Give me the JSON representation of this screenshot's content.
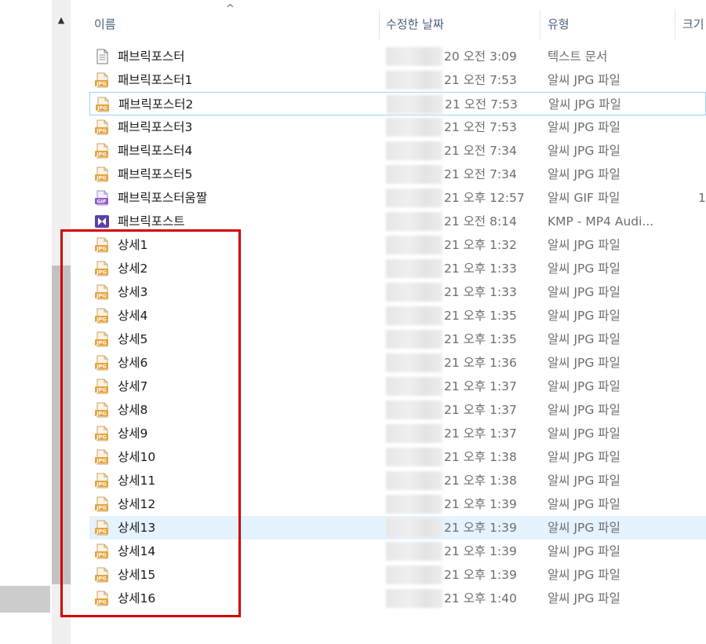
{
  "header": {
    "name": "이름",
    "date": "수정한 날짜",
    "type": "유형",
    "size": "크기"
  },
  "colors": {
    "header_text": "#4c607a",
    "secondary_text": "#6d6d6d",
    "selected_bg": "#e5f3ff",
    "focus_border": "#99d1ff",
    "annotation_red": "#d40000",
    "jpg_icon": "#e8a33d",
    "gif_icon": "#8b5cc9",
    "kmp_icon": "#5b3fa8"
  },
  "files": [
    {
      "icon": "text-file-icon",
      "name": "패브릭포스터",
      "date": "20 오전 3:09",
      "type": "텍스트 문서",
      "size": ""
    },
    {
      "icon": "jpg-file-icon",
      "name": "패브릭포스터1",
      "date": "21 오전 7:53",
      "type": "알씨 JPG 파일",
      "size": ""
    },
    {
      "icon": "jpg-file-icon",
      "name": "패브릭포스터2",
      "date": "21 오전 7:53",
      "type": "알씨 JPG 파일",
      "size": "",
      "state": "focused"
    },
    {
      "icon": "jpg-file-icon",
      "name": "패브릭포스터3",
      "date": "21 오전 7:53",
      "type": "알씨 JPG 파일",
      "size": ""
    },
    {
      "icon": "jpg-file-icon",
      "name": "패브릭포스터4",
      "date": "21 오전 7:34",
      "type": "알씨 JPG 파일",
      "size": ""
    },
    {
      "icon": "jpg-file-icon",
      "name": "패브릭포스터5",
      "date": "21 오전 7:34",
      "type": "알씨 JPG 파일",
      "size": ""
    },
    {
      "icon": "gif-file-icon",
      "name": "패브릭포스터움짤",
      "date": "21 오후 12:57",
      "type": "알씨 GIF 파일",
      "size": "1"
    },
    {
      "icon": "kmp-video-icon",
      "name": "패브릭포스트",
      "date": "21 오전 8:14",
      "type": "KMP - MP4 Audi...",
      "size": ""
    },
    {
      "icon": "jpg-file-icon",
      "name": "상세1",
      "date": "21 오후 1:32",
      "type": "알씨 JPG 파일",
      "size": ""
    },
    {
      "icon": "jpg-file-icon",
      "name": "상세2",
      "date": "21 오후 1:33",
      "type": "알씨 JPG 파일",
      "size": ""
    },
    {
      "icon": "jpg-file-icon",
      "name": "상세3",
      "date": "21 오후 1:33",
      "type": "알씨 JPG 파일",
      "size": ""
    },
    {
      "icon": "jpg-file-icon",
      "name": "상세4",
      "date": "21 오후 1:35",
      "type": "알씨 JPG 파일",
      "size": ""
    },
    {
      "icon": "jpg-file-icon",
      "name": "상세5",
      "date": "21 오후 1:35",
      "type": "알씨 JPG 파일",
      "size": ""
    },
    {
      "icon": "jpg-file-icon",
      "name": "상세6",
      "date": "21 오후 1:36",
      "type": "알씨 JPG 파일",
      "size": ""
    },
    {
      "icon": "jpg-file-icon",
      "name": "상세7",
      "date": "21 오후 1:37",
      "type": "알씨 JPG 파일",
      "size": ""
    },
    {
      "icon": "jpg-file-icon",
      "name": "상세8",
      "date": "21 오후 1:37",
      "type": "알씨 JPG 파일",
      "size": ""
    },
    {
      "icon": "jpg-file-icon",
      "name": "상세9",
      "date": "21 오후 1:37",
      "type": "알씨 JPG 파일",
      "size": ""
    },
    {
      "icon": "jpg-file-icon",
      "name": "상세10",
      "date": "21 오후 1:38",
      "type": "알씨 JPG 파일",
      "size": ""
    },
    {
      "icon": "jpg-file-icon",
      "name": "상세11",
      "date": "21 오후 1:38",
      "type": "알씨 JPG 파일",
      "size": ""
    },
    {
      "icon": "jpg-file-icon",
      "name": "상세12",
      "date": "21 오후 1:39",
      "type": "알씨 JPG 파일",
      "size": ""
    },
    {
      "icon": "jpg-file-icon",
      "name": "상세13",
      "date": "21 오후 1:39",
      "type": "알씨 JPG 파일",
      "size": "",
      "state": "selected"
    },
    {
      "icon": "jpg-file-icon",
      "name": "상세14",
      "date": "21 오후 1:39",
      "type": "알씨 JPG 파일",
      "size": ""
    },
    {
      "icon": "jpg-file-icon",
      "name": "상세15",
      "date": "21 오후 1:39",
      "type": "알씨 JPG 파일",
      "size": ""
    },
    {
      "icon": "jpg-file-icon",
      "name": "상세16",
      "date": "21 오후 1:40",
      "type": "알씨 JPG 파일",
      "size": ""
    }
  ]
}
